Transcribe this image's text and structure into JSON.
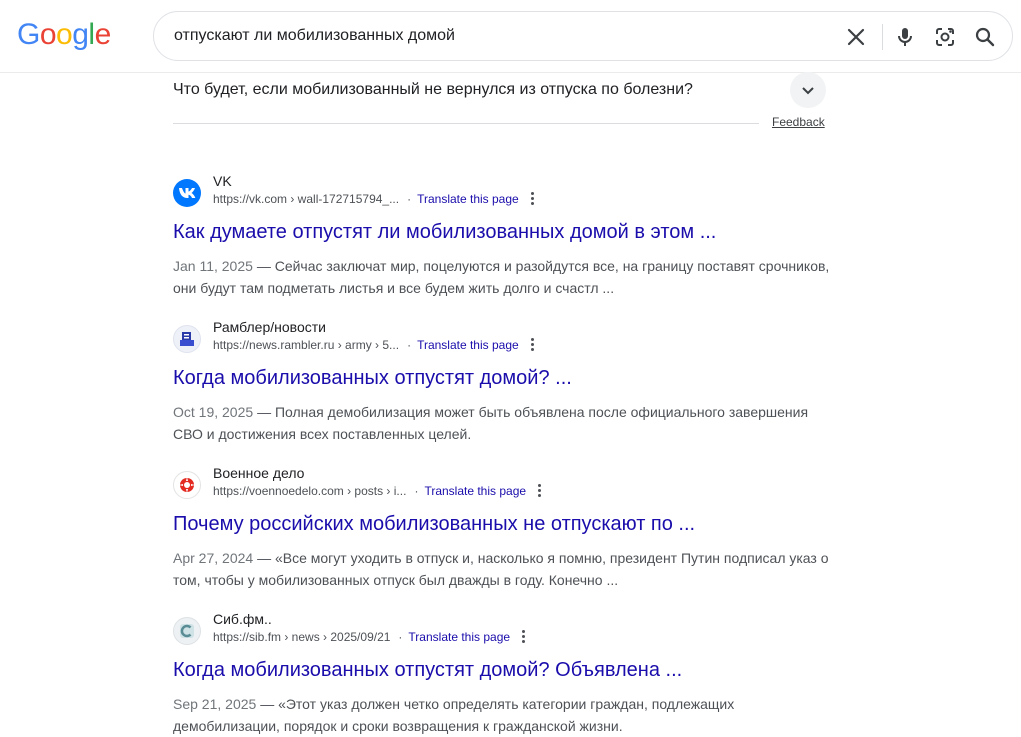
{
  "header": {
    "logo_text": "Google",
    "query": "отпускают ли мобилизованных домой",
    "icons": [
      "close-icon",
      "microphone-icon",
      "lens-icon",
      "search-icon"
    ]
  },
  "paa": {
    "question": "Что будет, если мобилизованный не вернулся из отпуска по болезни?",
    "feedback": "Feedback"
  },
  "results": [
    {
      "site": "VK",
      "cite": "https://vk.com › wall-172715794_...",
      "translate": "Translate this page",
      "title": "Как думаете отпустят ли мобилизованных домой в этом ...",
      "date": "Jan 11, 2025",
      "snippet": "Сейчас заключат мир, поцелуются и разойдутся все, на границу поставят срочников, они будут там подметать листья и все будем жить долго и счастл ..."
    },
    {
      "site": "Рамблер/новости",
      "cite": "https://news.rambler.ru › army › 5...",
      "translate": "Translate this page",
      "title": "Когда мобилизованных отпустят домой? ...",
      "date": "Oct 19, 2025",
      "snippet": "Полная демобилизация может быть объявлена после официального завершения СВО и достижения всех поставленных целей."
    },
    {
      "site": "Военное дело",
      "cite": "https://voennoedelo.com › posts › i...",
      "translate": "Translate this page",
      "title": "Почему российских мобилизованных не отпускают по ...",
      "date": "Apr 27, 2024",
      "snippet": "«Все могут уходить в отпуск и, насколько я помню, президент Путин подписал указ о том, чтобы у мобилизованных отпуск был дважды в году. Конечно ..."
    },
    {
      "site": "Сиб.фм..",
      "cite": "https://sib.fm › news › 2025/09/21",
      "translate": "Translate this page",
      "title": "Когда мобилизованных отпустят домой? Объявлена ...",
      "date": "Sep 21, 2025",
      "snippet": "«Этот указ должен четко определять категории граждан, подлежащих демобилизации, порядок и сроки возвращения к гражданской жизни."
    }
  ],
  "ui": {
    "dash": "—",
    "dot": "·"
  },
  "colors": {
    "link": "#1a0dab",
    "text": "#202124",
    "muted": "#4d5156",
    "vk": "#0077ff"
  }
}
